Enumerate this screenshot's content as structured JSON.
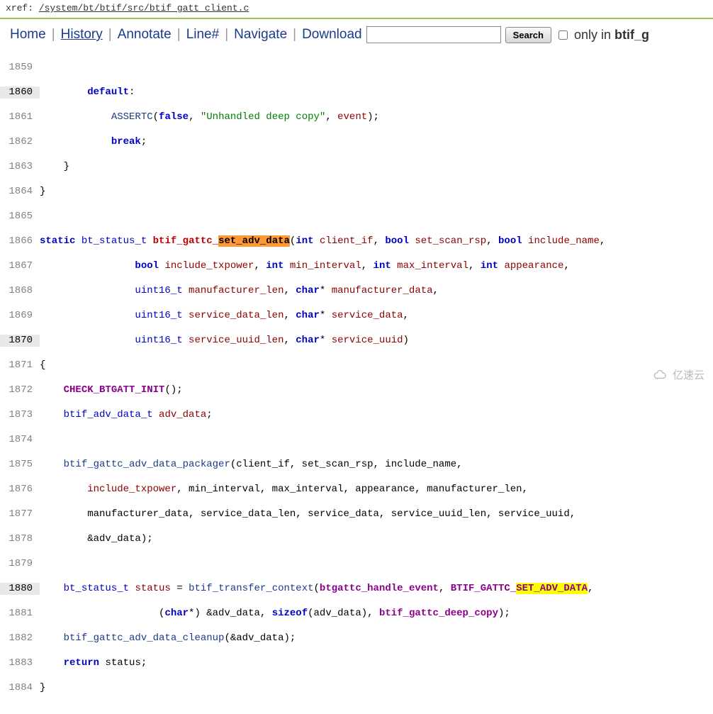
{
  "xref": {
    "label": "xref: ",
    "path": "/system/bt/btif/src/btif_gatt_client.c"
  },
  "nav": {
    "home": "Home",
    "history": "History",
    "annotate": "Annotate",
    "line": "Line#",
    "navigate": "Navigate",
    "download": "Download",
    "search_placeholder": "",
    "search_btn": "Search",
    "only_in_prefix": "only in ",
    "only_in_bold": "btif_g"
  },
  "code": {
    "l1859": "",
    "l1860_default": "default",
    "l1861_assert": "ASSERTC",
    "l1861_false": "false",
    "l1861_str": "\"Unhandled deep copy\"",
    "l1861_event": "event",
    "l1862_break": "break",
    "l1866_static": "static",
    "l1866_bt_status_t": "bt_status_t",
    "l1866_fn_pre": "btif_gattc_",
    "l1866_fn_hl": "set_adv_data",
    "l1866_int1": "int",
    "l1866_client_if": "client_if",
    "l1866_bool1": "bool",
    "l1866_set_scan_rsp": "set_scan_rsp",
    "l1866_bool2": "bool",
    "l1866_include_name": "include_name",
    "l1867_bool": "bool",
    "l1867_include_txpower": "include_txpower",
    "l1867_int1": "int",
    "l1867_min": "min_interval",
    "l1867_int2": "int",
    "l1867_max": "max_interval",
    "l1867_int3": "int",
    "l1867_appearance": "appearance",
    "l1868_u16": "uint16_t",
    "l1868_mlen": "manufacturer_len",
    "l1868_char": "char",
    "l1868_mdata": "manufacturer_data",
    "l1869_u16": "uint16_t",
    "l1869_sdlen": "service_data_len",
    "l1869_char": "char",
    "l1869_sdata": "service_data",
    "l1870_u16": "uint16_t",
    "l1870_sulen": "service_uuid_len",
    "l1870_char": "char",
    "l1870_suuid": "service_uuid",
    "l1872_macro": "CHECK_BTGATT_INIT",
    "l1873_type": "btif_adv_data_t",
    "l1873_var": "adv_data",
    "l1875_call": "btif_gattc_adv_data_packager",
    "l1875_args": "client_if, set_scan_rsp, include_name",
    "l1876_inc": "include_txpower",
    "l1876_rest": ", min_interval, max_interval, appearance, manufacturer_len,",
    "l1877_line": "manufacturer_data, service_data_len, service_data, service_uuid_len, service_uuid,",
    "l1878_line": "&adv_data);",
    "l1880_type": "bt_status_t",
    "l1880_status": "status",
    "l1880_call": "btif_transfer_context",
    "l1880_handle": "btgattc_handle_event",
    "l1880_const_pre": "BTIF_GATTC_",
    "l1880_const_hl": "SET_ADV_DATA",
    "l1881_char": "char",
    "l1881_adv": "adv_data",
    "l1881_sizeof": "sizeof",
    "l1881_deep": "btif_gattc_deep_copy",
    "l1882_call": "btif_gattc_adv_data_cleanup",
    "l1882_arg": "&adv_data",
    "l1883_return": "return",
    "l1883_status": "status"
  },
  "watermark": "亿速云"
}
